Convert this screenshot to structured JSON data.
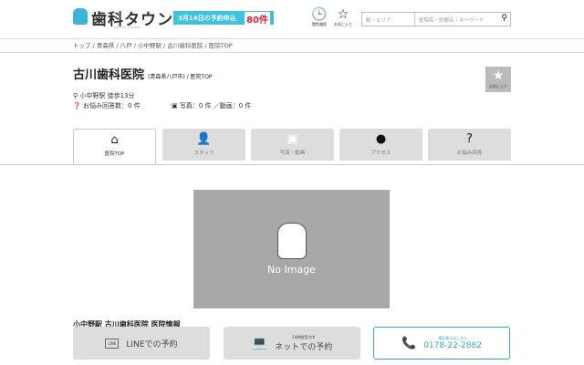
{
  "header": {
    "logo": "歯科タウン",
    "logo_sub": "SHIKA TOWN",
    "banner_text": "3月14日の予約申込",
    "banner_count": "80件",
    "history_label": "閲覧履歴",
    "favorite_label": "お気に入り",
    "area_placeholder": "駅・エリア",
    "keyword_placeholder": "医院名・診療名・キーワード"
  },
  "breadcrumb": "トップ / 青森県 / 八戸 / 小中野駅 / 古川歯科医院 / 医院TOP",
  "clinic": {
    "name": "古川歯科医院",
    "region": "(青森県八戸市) / 医院TOP",
    "fav_label": "お気に入り",
    "access": "小中野駅 徒歩13分",
    "answers": "お悩み回答数：0 件",
    "media": "写真：0 件 ／動画：0 件"
  },
  "tabs": [
    {
      "label": "医院TOP"
    },
    {
      "label": "スタッフ"
    },
    {
      "label": "写真・動画"
    },
    {
      "label": "アクセス"
    },
    {
      "label": "お悩み回答"
    }
  ],
  "no_image": "No Image",
  "section_title": "小中野駅 古川歯科医院 医院情報",
  "actions": {
    "line": "LINEでの予約",
    "net_small": "24時間受付中",
    "net": "ネットでの予約",
    "tel_small": "電話番号はこちら",
    "tel": "0178-22-2882"
  }
}
